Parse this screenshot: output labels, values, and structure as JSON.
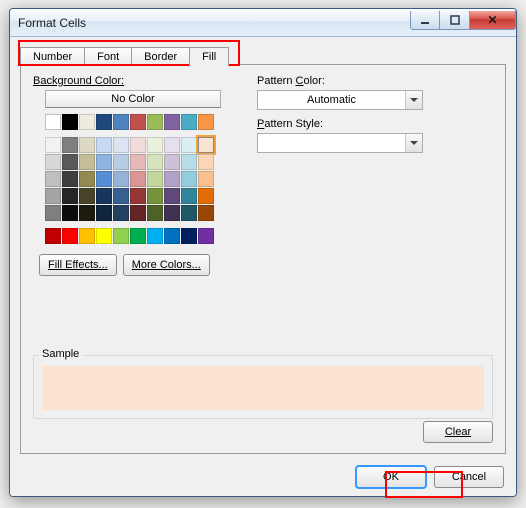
{
  "dialog": {
    "title": "Format Cells"
  },
  "tabs": {
    "number": "Number",
    "font": "Font",
    "border": "Border",
    "fill": "Fill"
  },
  "labels": {
    "bg_color": "Background Color:",
    "no_color": "No Color",
    "pat_color_pre": "Pattern ",
    "pat_color_u": "C",
    "pat_color_post": "olor:",
    "pat_style_pre": "",
    "pat_style_u": "P",
    "pat_style_post": "attern Style:",
    "pat_color_val": "Automatic",
    "fill_effects": "Fill Effects...",
    "more_colors": "More Colors...",
    "sample": "Sample",
    "clear": "Clear",
    "ok": "OK",
    "cancel": "Cancel"
  },
  "sample_color": "#fbe3d2",
  "palette_top": [
    [
      "#ffffff",
      "#000000",
      "#eeece1",
      "#1f497d",
      "#4f81bd",
      "#c0504d",
      "#9bbb59",
      "#8064a2",
      "#4bacc6",
      "#f79646"
    ]
  ],
  "palette_theme": [
    [
      "#f2f2f2",
      "#7f7f7f",
      "#ddd9c3",
      "#c6d9f0",
      "#dbe5f1",
      "#f2dcdb",
      "#ebf1dd",
      "#e5e0ec",
      "#dbeef3",
      "#fbe3d2"
    ],
    [
      "#d8d8d8",
      "#595959",
      "#c4bd97",
      "#8db3e2",
      "#b8cce4",
      "#e5b9b7",
      "#d7e3bc",
      "#ccc1d9",
      "#b7dde8",
      "#fbd5b5"
    ],
    [
      "#bfbfbf",
      "#3f3f3f",
      "#938953",
      "#548dd4",
      "#95b3d7",
      "#d99694",
      "#c3d69b",
      "#b2a2c7",
      "#92cddc",
      "#fac08f"
    ],
    [
      "#a5a5a5",
      "#262626",
      "#494429",
      "#17365d",
      "#366092",
      "#953734",
      "#76923c",
      "#5f497a",
      "#31859b",
      "#e36c09"
    ],
    [
      "#7f7f7f",
      "#0c0c0c",
      "#1d1b10",
      "#0f243e",
      "#244061",
      "#632423",
      "#4f6128",
      "#3f3151",
      "#205867",
      "#974806"
    ]
  ],
  "palette_std": [
    [
      "#c00000",
      "#ff0000",
      "#ffc000",
      "#ffff00",
      "#92d050",
      "#00b050",
      "#00b0f0",
      "#0070c0",
      "#002060",
      "#7030a0"
    ]
  ]
}
